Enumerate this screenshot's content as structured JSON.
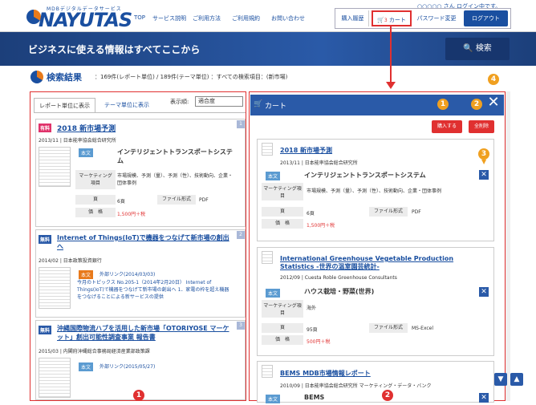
{
  "header": {
    "logo_sub": "MDBデジタルデータサービス",
    "logo": "NAYUTAS",
    "nav": [
      "TOP",
      "サービス説明",
      "ご利用方法",
      "ご利用規約",
      "お問い合わせ"
    ],
    "user_line": "○○○○○ さん ログイン中です。",
    "history": "購入履歴",
    "cart_count": "3",
    "cart": "カート",
    "password": "パスワード変更",
    "logout": "ログアウト"
  },
  "banner": {
    "text": "ビジネスに使える情報はすべてここから",
    "search": "検索"
  },
  "results": {
    "title": "検索結果",
    "meta": "：169件(レポート単位) / 189件(テーマ単位) ：すべての検索項目：(新市場)"
  },
  "left": {
    "tab_report": "レポート単位に表示",
    "tab_theme": "テーマ単位に表示",
    "sort_label": "表示順:",
    "sort_value": "適合度",
    "items": [
      {
        "num": "1",
        "badge": "有料",
        "title": "2018 新市場予測",
        "meta": "2013/11 | 日本能率協会総合研究所",
        "tag": "本文",
        "theme": "インテリジェントトランスポートシステム",
        "mk_label": "マーケティング項目",
        "mk": "市場規模、予測（量）、予測（性）、技術動向、企業・団体事例",
        "page_label": "頁",
        "page": "6頁",
        "format_label": "ファイル形式",
        "format": "PDF",
        "price_label": "価　格",
        "price": "1,500円＋税"
      },
      {
        "num": "2",
        "badge": "無料",
        "title": "Internet of Things(IoT)で機器をつなげて新市場の創出へ",
        "meta": "2014/02 | 日本政策投資銀行",
        "tag": "本文",
        "link": "外部リンク",
        "link_date": "(2014/03/03)",
        "body": "今月のトピックス No.205-1（2014年2月20日） Internet of Things(IoT)で機器をつなげて新市場の創出へ 1．家電の枠を超え機器をつなげることによる新サービスの提供"
      },
      {
        "num": "3",
        "badge": "無料",
        "title": "沖縄国際物流ハブを活用した新市場「OTORIYOSE マーケット」創出可能性調査事業 報告書",
        "meta": "2015/03 | 内閣府沖縄総合事務局経済産業部政策課",
        "tag": "本文",
        "link": "外部リンク",
        "link_date": "(2015/05/27)"
      }
    ]
  },
  "cart": {
    "title": "カート",
    "buy": "購入する",
    "delete_all": "全削除",
    "items": [
      {
        "title": "2018 新市場予測",
        "meta": "2013/11 | 日本能率協会総合研究所",
        "tag": "本文",
        "theme": "インテリジェントトランスポートシステム",
        "mk_label": "マーケティング項目",
        "mk": "市場規模、予測（量）、予測（性）、技術動向、企業・団体事例",
        "page_label": "頁",
        "page": "6頁",
        "format_label": "ファイル形式",
        "format": "PDF",
        "price_label": "価　格",
        "price": "1,500円＋税"
      },
      {
        "title": "International Greenhouse Vegetable Production Statistics -世界の温室園芸統計-",
        "meta": "2012/09 | Cuesta Roble Greenhouse Consultants",
        "tag": "本文",
        "theme": "ハウス栽培・野菜(世界)",
        "mk_label": "マーケティング項目",
        "mk": "海外",
        "page_label": "頁",
        "page": "95頁",
        "format_label": "ファイル形式",
        "format": "MS-Excel",
        "price_label": "価　格",
        "price": "500円＋税"
      },
      {
        "title": "BEMS MDB市場情報レポート",
        "meta": "2010/09 | 日本能率協会総合研究所 マーケティング・データ・バンク",
        "tag": "本文",
        "theme": "BEMS"
      }
    ]
  },
  "markers": {
    "m1": "1",
    "m2": "2",
    "m3": "3",
    "m4": "4",
    "r1": "1",
    "r2": "2"
  }
}
